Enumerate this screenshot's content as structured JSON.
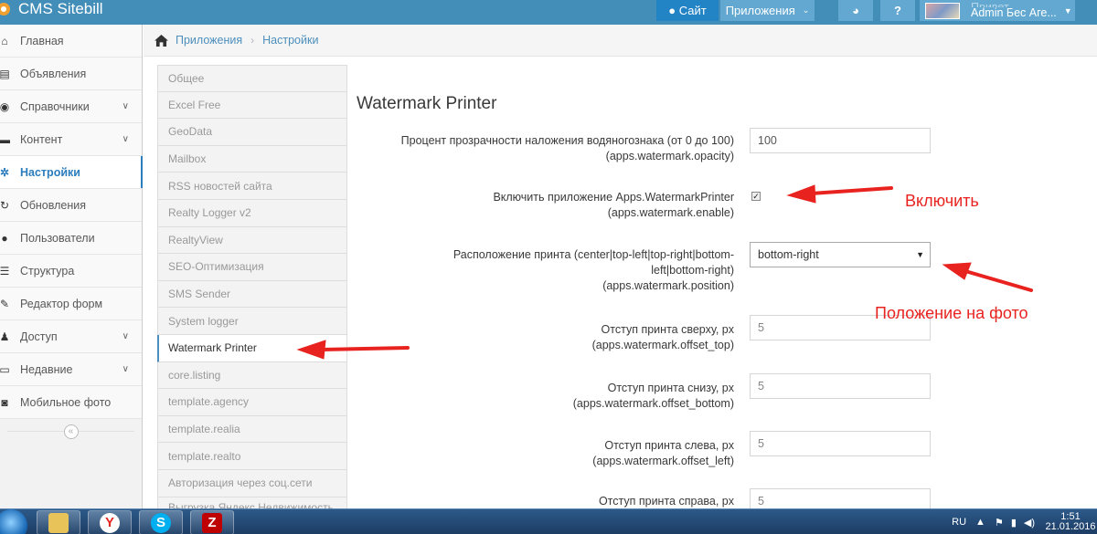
{
  "navbar": {
    "brand": "CMS Sitebill",
    "site_button": "● Сайт",
    "apps_button": "Приложения",
    "globe_icon": "globe-icon",
    "help_icon": "question-icon",
    "user_greeting": "Привет,",
    "user_name": "Admin Бес Аге..."
  },
  "sidebar": {
    "items": [
      {
        "label": "Главная",
        "icon": "home-icon",
        "has_children": false
      },
      {
        "label": "Объявления",
        "icon": "edit-icon",
        "has_children": false
      },
      {
        "label": "Справочники",
        "icon": "globe-icon",
        "has_children": true
      },
      {
        "label": "Контент",
        "icon": "keyboard-icon",
        "has_children": true
      },
      {
        "label": "Настройки",
        "icon": "gear-icon",
        "has_children": false,
        "active": true
      },
      {
        "label": "Обновления",
        "icon": "refresh-icon",
        "has_children": false
      },
      {
        "label": "Пользователи",
        "icon": "user-icon",
        "has_children": false
      },
      {
        "label": "Структура",
        "icon": "list-icon",
        "has_children": false
      },
      {
        "label": "Редактор форм",
        "icon": "pencil-square-icon",
        "has_children": false
      },
      {
        "label": "Доступ",
        "icon": "users-icon",
        "has_children": true
      },
      {
        "label": "Недавние",
        "icon": "desktop-icon",
        "has_children": true
      },
      {
        "label": "Мобильное фото",
        "icon": "camera-icon",
        "has_children": false
      }
    ],
    "collapse_label": "«"
  },
  "breadcrumbs": {
    "items": [
      "Приложения",
      "Настройки"
    ],
    "separator": "›"
  },
  "settings_list": {
    "items": [
      "Общее",
      "Excel Free",
      "GeoData",
      "Mailbox",
      "RSS новостей сайта",
      "Realty Logger v2",
      "RealtyView",
      "SEO-Оптимизация",
      "SMS Sender",
      "System logger",
      "Watermark Printer",
      "core.listing",
      "template.agency",
      "template.realia",
      "template.realto",
      "Авторизация через соц.сети",
      "Выгрузка Яндекс.Недвижимость"
    ],
    "active_index": 10
  },
  "panel": {
    "title": "Watermark Printer",
    "fields": [
      {
        "label": "Процент прозрачности наложения водяногознака (от 0 до 100)",
        "key": "(apps.watermark.opacity)",
        "type": "input",
        "value": "100"
      },
      {
        "label": "Включить приложение Apps.WatermarkPrinter",
        "key": "(apps.watermark.enable)",
        "type": "checkbox",
        "checked": true
      },
      {
        "label_line1": "Расположение принта (center|top-left|top-right|bottom-",
        "label_line2": "left|bottom-right)",
        "key": "(apps.watermark.position)",
        "type": "select",
        "value": "bottom-right"
      },
      {
        "label": "Отступ принта сверху, px",
        "key": "(apps.watermark.offset_top)",
        "type": "input",
        "value": "5"
      },
      {
        "label": "Отступ принта снизу, px",
        "key": "(apps.watermark.offset_bottom)",
        "type": "input",
        "value": "5"
      },
      {
        "label": "Отступ принта слева, px",
        "key": "(apps.watermark.offset_left)",
        "type": "input",
        "value": "5"
      },
      {
        "label": "Отступ принта справа, px",
        "key": "",
        "type": "input",
        "value": "5"
      }
    ]
  },
  "annotations": {
    "enable_note": "Включить",
    "position_note": "Положение на фото",
    "color": "#e8231f"
  },
  "taskbar": {
    "apps": [
      "explorer-icon",
      "yandex-icon",
      "skype-icon",
      "filezilla-icon"
    ],
    "lang": "RU",
    "time": "1:51",
    "date": "21.01.2016"
  }
}
